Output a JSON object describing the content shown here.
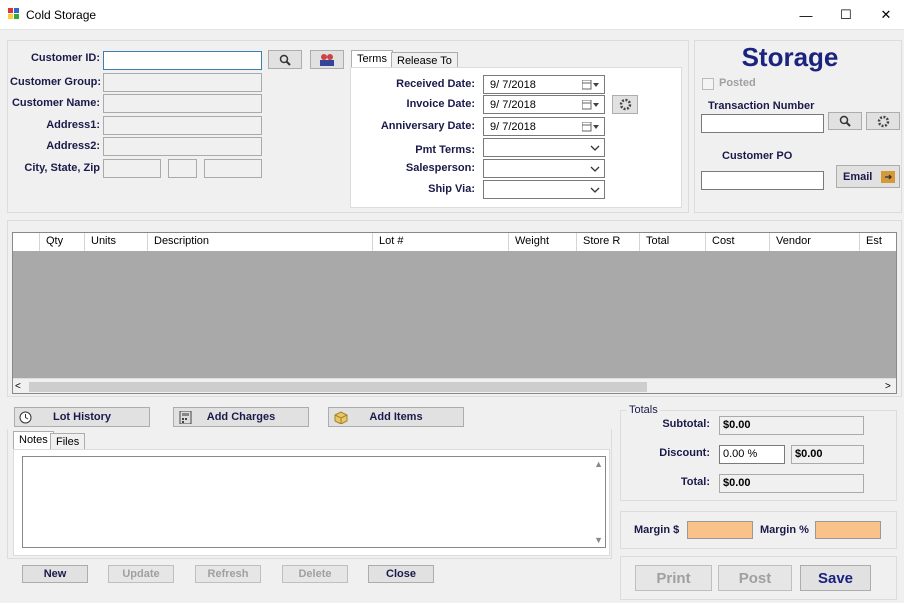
{
  "window": {
    "title": "Cold Storage",
    "minimize": "—",
    "maximize": "☐",
    "close": "✕"
  },
  "customer": {
    "id_label": "Customer ID:",
    "group_label": "Customer Group:",
    "name_label": "Customer Name:",
    "address1_label": "Address1:",
    "address2_label": "Address2:",
    "csz_label": "City, State, Zip"
  },
  "tabs_top": [
    "Terms",
    "Release To"
  ],
  "terms": {
    "received_label": "Received Date:",
    "received_value": "9/  7/2018",
    "invoice_label": "Invoice Date:",
    "invoice_value": "9/  7/2018",
    "anniversary_label": "Anniversary  Date:",
    "anniversary_value": "9/  7/2018",
    "pmt_label": "Pmt Terms:",
    "salesperson_label": "Salesperson:",
    "shipvia_label": "Ship Via:"
  },
  "storage": {
    "heading": "Storage",
    "posted_label": "Posted",
    "transaction_label": "Transaction Number",
    "customer_po_label": "Customer PO",
    "email_label": "Email"
  },
  "grid": {
    "columns": [
      "Qty",
      "Units",
      "Description",
      "Lot #",
      "Weight",
      "Store R",
      "Total",
      "Cost",
      "Vendor",
      "Est"
    ]
  },
  "actions": {
    "lot_history": "Lot History",
    "add_charges": "Add Charges",
    "add_items": "Add Items"
  },
  "notes_tabs": [
    "Notes",
    "Files"
  ],
  "bottom_buttons": {
    "new": "New",
    "update": "Update",
    "refresh": "Refresh",
    "delete": "Delete",
    "close": "Close"
  },
  "totals": {
    "group_label": "Totals",
    "subtotal_label": "Subtotal:",
    "subtotal_value": "$0.00",
    "discount_label": "Discount:",
    "discount_pct": "0.00 %",
    "discount_value": "$0.00",
    "total_label": "Total:",
    "total_value": "$0.00"
  },
  "margin": {
    "dollar_label": "Margin $",
    "pct_label": "Margin %",
    "fill_color": "#f9c28a"
  },
  "final_buttons": {
    "print": "Print",
    "post": "Post",
    "save": "Save"
  }
}
